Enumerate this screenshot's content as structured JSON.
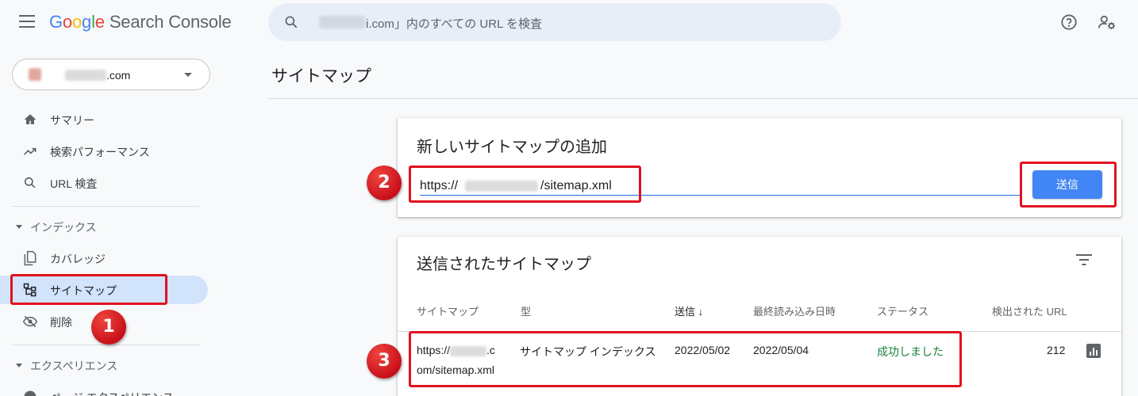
{
  "header": {
    "logo": [
      "G",
      "o",
      "o",
      "g",
      "l",
      "e"
    ],
    "product": "Search Console",
    "search_placeholder": "i.com」内のすべての URL を検査"
  },
  "property": {
    "domain_suffix": ".com"
  },
  "sidebar": {
    "items": [
      {
        "label": "サマリー",
        "icon": "home-icon"
      },
      {
        "label": "検索パフォーマンス",
        "icon": "trending-up-icon"
      },
      {
        "label": "URL 検査",
        "icon": "search-icon"
      }
    ],
    "index_section": "インデックス",
    "index_items": [
      {
        "label": "カバレッジ",
        "icon": "file-copy-icon"
      },
      {
        "label": "サイトマップ",
        "icon": "sitemap-icon"
      },
      {
        "label": "削除",
        "icon": "visibility-off-icon"
      }
    ],
    "experience_section": "エクスペリエンス",
    "experience_items": [
      {
        "label": "ページ エクスペリエンス",
        "icon": "page-experience-icon"
      }
    ]
  },
  "main": {
    "title": "サイトマップ",
    "add_card": {
      "title": "新しいサイトマップの追加",
      "url_prefix": "https://",
      "url_suffix": "/sitemap.xml",
      "submit_label": "送信"
    },
    "submitted_card": {
      "title": "送信されたサイトマップ",
      "columns": [
        "サイトマップ",
        "型",
        "送信",
        "最終読み込み日時",
        "ステータス",
        "検出された URL"
      ],
      "sort_indicator": "↓",
      "rows": [
        {
          "sitemap_prefix": "https://",
          "sitemap_mid": ".c",
          "sitemap_line2": "om/sitemap.xml",
          "type": "サイトマップ インデックス",
          "submitted": "2022/05/02",
          "last_read": "2022/05/04",
          "status": "成功しました",
          "discovered_urls": "212"
        }
      ]
    }
  },
  "annotations": {
    "badge1": "1",
    "badge2": "2",
    "badge3": "3"
  },
  "colors": {
    "accent": "#4285f4",
    "success": "#188038",
    "annotation": "#e0121f",
    "active_nav": "#d2e3fc"
  }
}
